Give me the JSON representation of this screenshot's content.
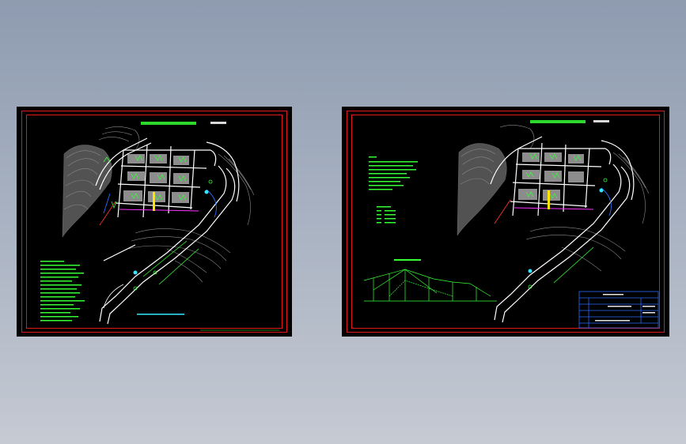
{
  "colors": {
    "background_top": "#8e9bb0",
    "background_bottom": "#c5cad3",
    "sheet": "#000000",
    "frame": "#e01818",
    "cad_green": "#36ff36",
    "terrain": "#8a8a8a",
    "road": "#ffffff",
    "accent_blue": "#2a6bff",
    "accent_magenta": "#ff33ff",
    "accent_yellow": "#ffe400",
    "accent_cyan": "#33e6ff"
  },
  "sheets": [
    {
      "id": "left",
      "contents": [
        "site-plan",
        "notes-block",
        "scale-note",
        "plan-title",
        "scale-label"
      ]
    },
    {
      "id": "right",
      "contents": [
        "site-plan",
        "notes-block",
        "legend",
        "section-profile",
        "title-block",
        "plan-title",
        "scale-label"
      ]
    }
  ],
  "icons": [
    "cad-drawing-thumbnail"
  ]
}
